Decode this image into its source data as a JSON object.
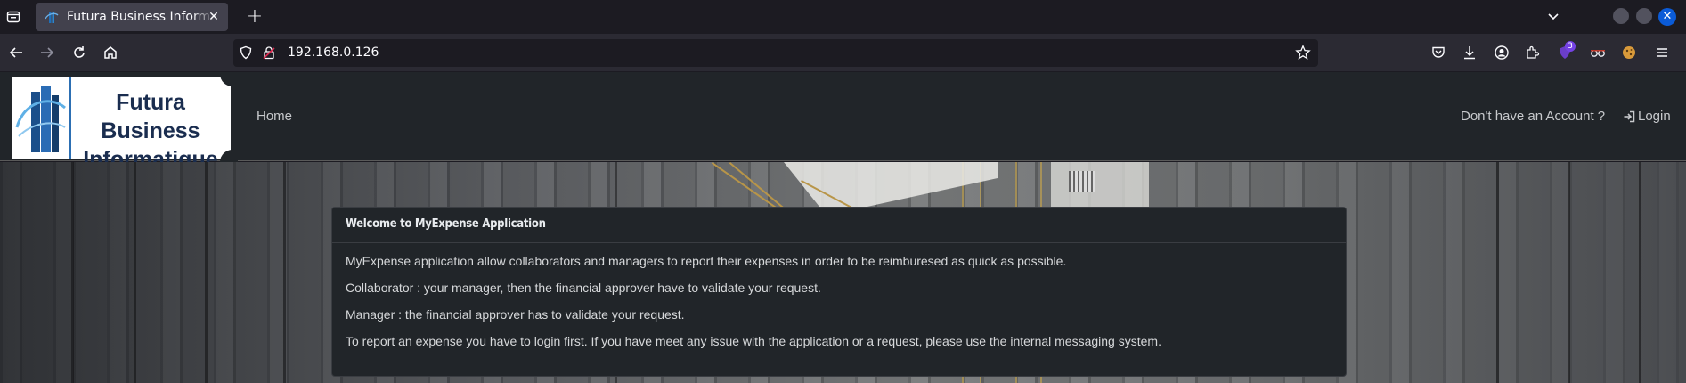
{
  "browser": {
    "tab": {
      "title": "Futura Business Informatique"
    },
    "url": "192.168.0.126",
    "extension_badge": "3",
    "icons": [
      "tab-list-icon",
      "new-tab-icon",
      "list-all-tabs-chevron-icon",
      "back-icon",
      "forward-icon",
      "reload-icon",
      "home-icon",
      "shield-icon",
      "lock-icon",
      "bookmark-star-icon",
      "pocket-icon",
      "download-icon",
      "account-icon",
      "extensions-icon",
      "menu-icon"
    ]
  },
  "site": {
    "logo": {
      "line1": "Futura Business",
      "line2": "Informatique"
    },
    "nav": {
      "home": "Home"
    },
    "auth": {
      "signup": "Don't have an Account ?",
      "login": "Login"
    }
  },
  "card": {
    "title": "Welcome to MyExpense Application",
    "lines": [
      "MyExpense application allow collaborators and managers to report their expenses in order to be reimburesed as quick as possible.",
      "Collaborator : your manager, then the financial approver have to validate your request.",
      "Manager : the financial approver has to validate your request.",
      "To report an expense you have to login first. If you have meet any issue with the application or a request, please use the internal messaging system."
    ]
  },
  "colors": {
    "accent": "#0b5bd7",
    "header_bg": "#212529",
    "card_bg": "#212529",
    "badge": "#7542e5"
  }
}
